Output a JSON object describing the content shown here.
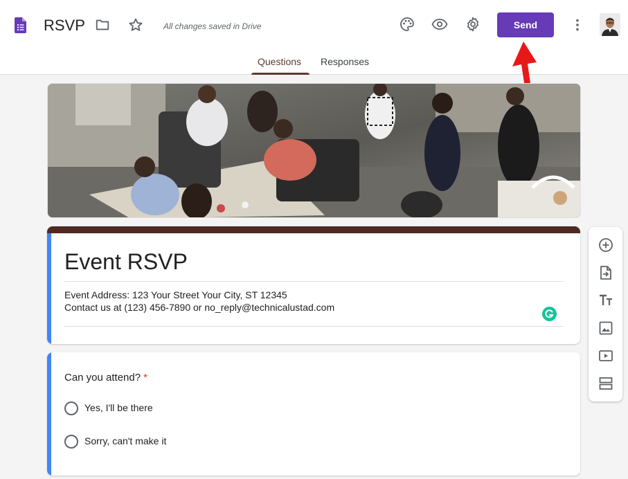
{
  "header": {
    "title": "RSVP",
    "save_status": "All changes saved in Drive",
    "send_label": "Send",
    "brand_color": "#673ab7"
  },
  "tabs": [
    {
      "label": "Questions",
      "active": true
    },
    {
      "label": "Responses",
      "active": false
    }
  ],
  "form": {
    "title": "Event RSVP",
    "description_lines": [
      "Event Address: 123 Your Street Your City, ST 12345",
      "Contact us at (123) 456-7890 or no_reply@technicalustad.com"
    ],
    "theme_color": "#4e2a22",
    "accent_color": "#4285f4"
  },
  "question": {
    "title": "Can you attend?",
    "required_marker": "*",
    "options": [
      "Yes,  I'll be there",
      "Sorry, can't make it"
    ]
  },
  "toolbar": {
    "icons": [
      "add-question-icon",
      "import-questions-icon",
      "add-title-icon",
      "add-image-icon",
      "add-video-icon",
      "add-section-icon"
    ]
  },
  "icons": {
    "header": [
      "forms-logo-icon",
      "folder-icon",
      "star-icon",
      "palette-icon",
      "eye-icon",
      "gear-icon",
      "more-vert-icon"
    ]
  }
}
